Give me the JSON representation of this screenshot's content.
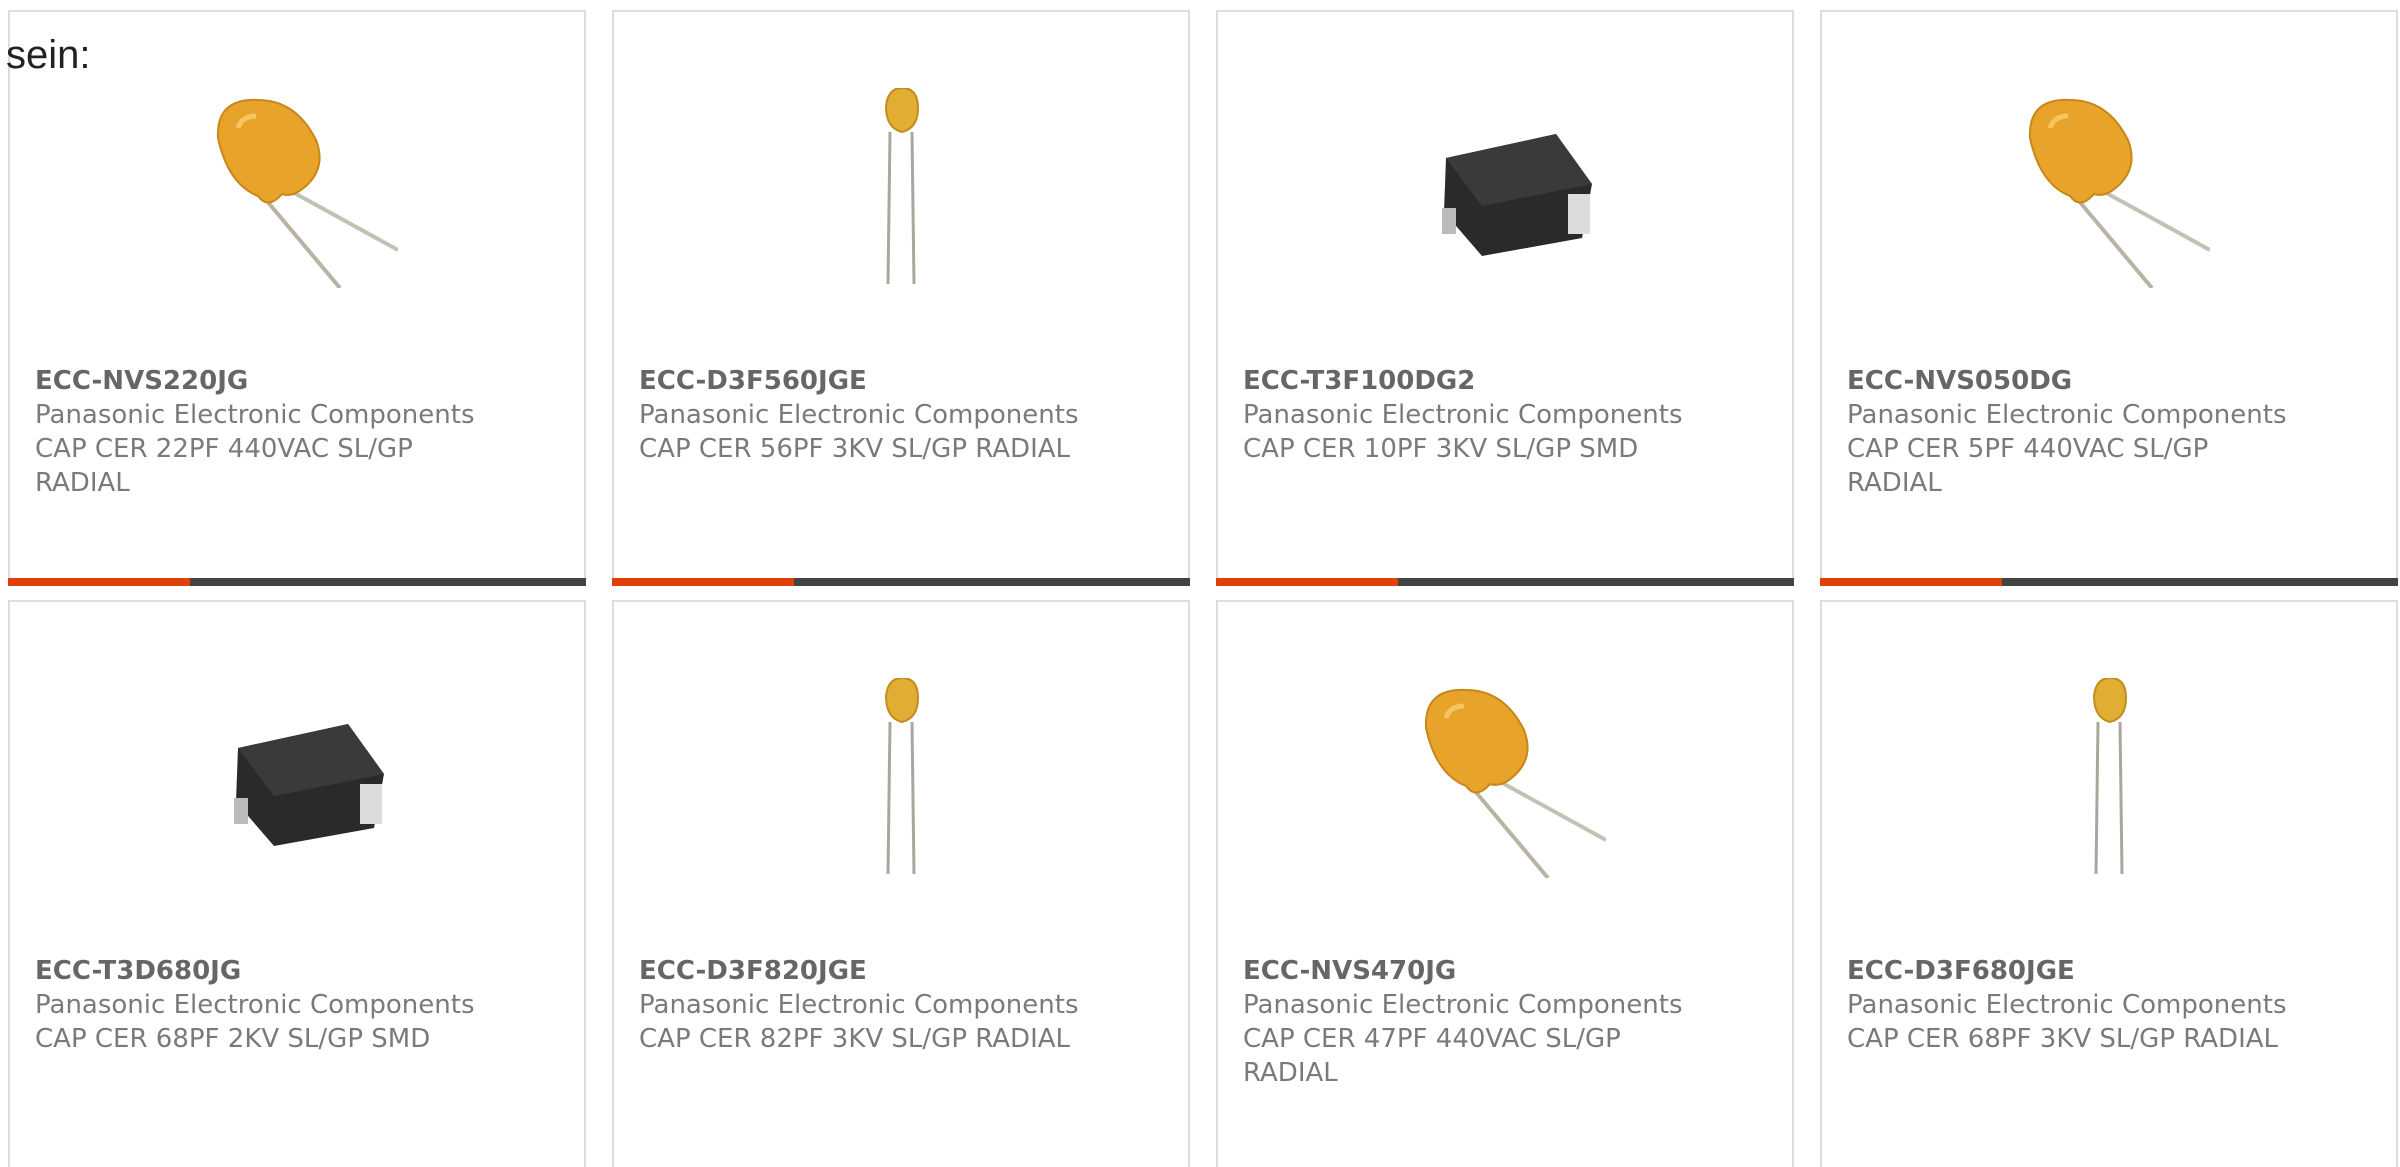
{
  "lead_text": "sein:",
  "colors": {
    "accent": "#e0400a",
    "bar": "#444444",
    "border": "#dcdcdc",
    "text": "#7a7a7a"
  },
  "products": [
    {
      "part_number": "ECC-NVS220JG",
      "manufacturer": "Panasonic Electronic Components",
      "description": "CAP CER 22PF 440VAC SL/GP RADIAL",
      "image": "disc-capacitor-large-icon"
    },
    {
      "part_number": "ECC-D3F560JGE",
      "manufacturer": "Panasonic Electronic Components",
      "description": "CAP CER 56PF 3KV SL/GP RADIAL",
      "image": "disc-capacitor-small-icon"
    },
    {
      "part_number": "ECC-T3F100DG2",
      "manufacturer": "Panasonic Electronic Components",
      "description": "CAP CER 10PF 3KV SL/GP SMD",
      "image": "smd-capacitor-icon"
    },
    {
      "part_number": "ECC-NVS050DG",
      "manufacturer": "Panasonic Electronic Components",
      "description": "CAP CER 5PF 440VAC SL/GP RADIAL",
      "image": "disc-capacitor-large-icon"
    },
    {
      "part_number": "ECC-T3D680JG",
      "manufacturer": "Panasonic Electronic Components",
      "description": "CAP CER 68PF 2KV SL/GP SMD",
      "image": "smd-capacitor-icon"
    },
    {
      "part_number": "ECC-D3F820JGE",
      "manufacturer": "Panasonic Electronic Components",
      "description": "CAP CER 82PF 3KV SL/GP RADIAL",
      "image": "disc-capacitor-small-icon"
    },
    {
      "part_number": "ECC-NVS470JG",
      "manufacturer": "Panasonic Electronic Components",
      "description": "CAP CER 47PF 440VAC SL/GP RADIAL",
      "image": "disc-capacitor-large-icon"
    },
    {
      "part_number": "ECC-D3F680JGE",
      "manufacturer": "Panasonic Electronic Components",
      "description": "CAP CER 68PF 3KV SL/GP RADIAL",
      "image": "disc-capacitor-small-icon"
    }
  ]
}
